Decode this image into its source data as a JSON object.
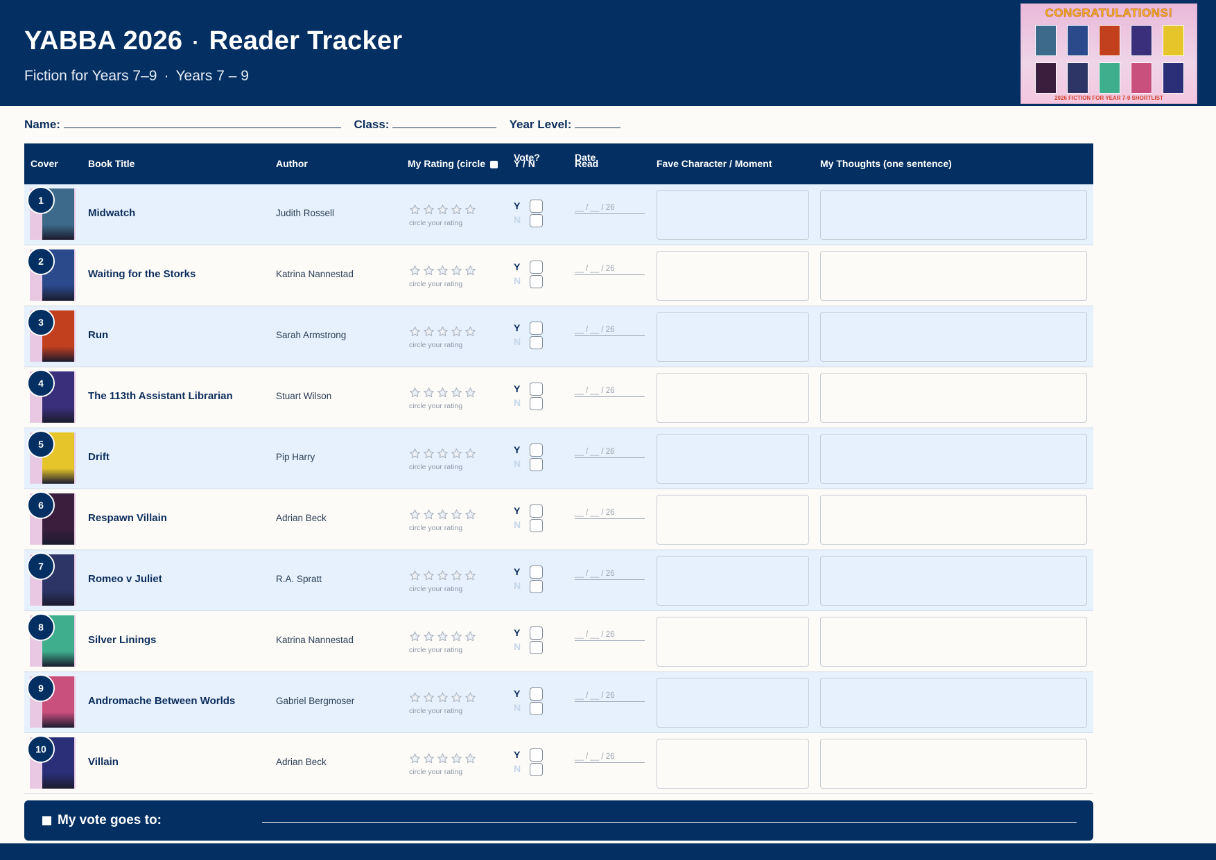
{
  "header": {
    "title_main": "YABBA 2026",
    "title_sep": "·",
    "title_sub": "Reader Tracker",
    "subtitle_a": "Fiction for Years 7–9",
    "subtitle_sep": "·",
    "subtitle_b": "Years 7 – 9"
  },
  "shortlist_image": {
    "banner": "CONGRATULATIONS!",
    "caption": "2026 FICTION FOR YEAR 7-9 SHORTLIST"
  },
  "fields": {
    "name_label": "Name:",
    "class_label": "Class:",
    "year_label": "Year Level:"
  },
  "columns": {
    "cover": "Cover",
    "title": "Book Title",
    "author": "Author",
    "rating": "My Rating (circle",
    "vote_line1": "Vote?",
    "vote_line2": "Y / N",
    "date_line1": "Date",
    "date_line2": "Read",
    "fave": "Fave Character / Moment",
    "thoughts": "My Thoughts (one sentence)"
  },
  "row_labels": {
    "rating_hint": "circle your rating",
    "yes": "Y",
    "no": "N",
    "date_placeholder": "__ / __ / 26"
  },
  "books": [
    {
      "num": "1",
      "title": "Midwatch",
      "author": "Judith Rossell",
      "cover_color": "#3d6a8a"
    },
    {
      "num": "2",
      "title": "Waiting for the Storks",
      "author": "Katrina Nannestad",
      "cover_color": "#2a4a8c"
    },
    {
      "num": "3",
      "title": "Run",
      "author": "Sarah Armstrong",
      "cover_color": "#c2401e"
    },
    {
      "num": "4",
      "title": "The 113th Assistant Librarian",
      "author": "Stuart Wilson",
      "cover_color": "#3a2f7a"
    },
    {
      "num": "5",
      "title": "Drift",
      "author": "Pip Harry",
      "cover_color": "#e6c52a"
    },
    {
      "num": "6",
      "title": "Respawn Villain",
      "author": "Adrian Beck",
      "cover_color": "#3b1e3e"
    },
    {
      "num": "7",
      "title": "Romeo v Juliet",
      "author": "R.A. Spratt",
      "cover_color": "#2c3566"
    },
    {
      "num": "8",
      "title": "Silver Linings",
      "author": "Katrina Nannestad",
      "cover_color": "#3fae8c"
    },
    {
      "num": "9",
      "title": "Andromache Between Worlds",
      "author": "Gabriel Bergmoser",
      "cover_color": "#c94f7c"
    },
    {
      "num": "10",
      "title": "Villain",
      "author": "Adrian Beck",
      "cover_color": "#2a2f78"
    }
  ],
  "vote_bar": {
    "label": "My vote goes to:"
  },
  "colors": {
    "navy": "#032f62",
    "row_tint": "#e6f1fd",
    "paper": "#fdfbf7"
  }
}
